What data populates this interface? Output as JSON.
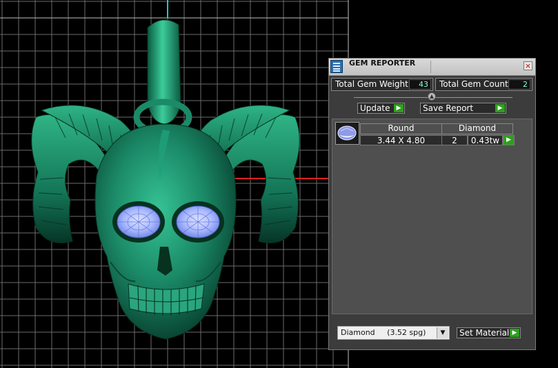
{
  "panel": {
    "title": "GEM REPORTER",
    "close_glyph": "×",
    "total_gem_weight": {
      "label": "Total Gem Weight",
      "value": "43"
    },
    "total_gem_count": {
      "label": "Total Gem Count",
      "value": "2"
    },
    "update_label": "Update",
    "save_report_label": "Save Report",
    "results_header": {
      "shape": "Round",
      "material": "Diamond"
    },
    "results_rows": [
      {
        "size": "3.44 X 4.80",
        "count": "2",
        "weight": "0.43tw"
      }
    ],
    "material_select": {
      "value": "Diamond     (3.52 spg)"
    },
    "set_material_label": "Set Material"
  },
  "icons": {
    "play": "play-arrow-icon",
    "close": "close-icon",
    "dropdown": "chevron-down-icon",
    "gem": "gem-thumbnail-icon",
    "app": "gem-reporter-app-icon"
  },
  "colors": {
    "model": "#1b8a67",
    "gem": "#aab9ff",
    "accent_button": "#2f9f1e",
    "value_text": "#88ddcc",
    "grid": "#7f7f7f"
  }
}
